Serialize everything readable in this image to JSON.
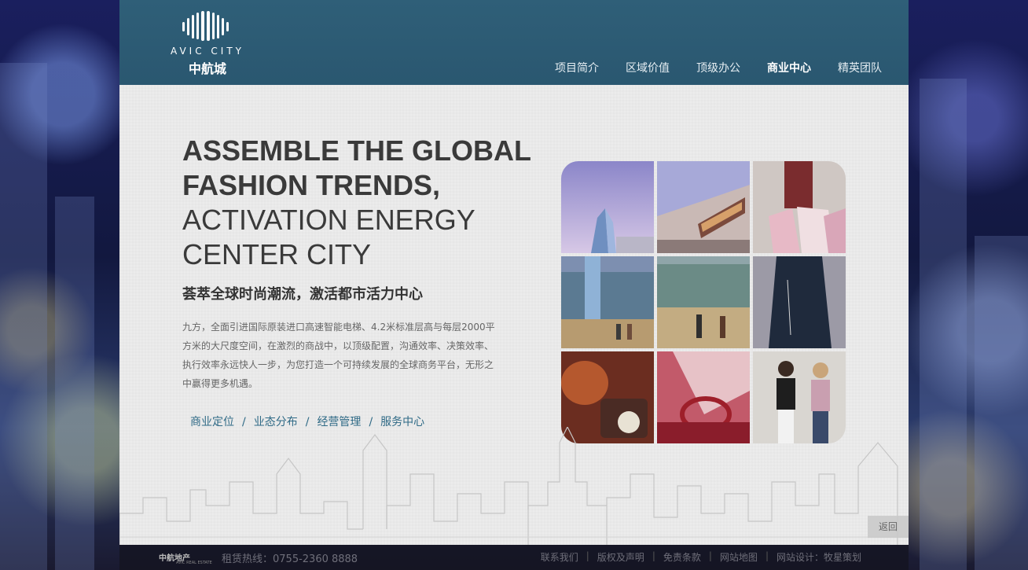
{
  "brand": {
    "logo_en": "AVIC CITY",
    "logo_cn": "中航城"
  },
  "nav": {
    "items": [
      {
        "label": "项目简介"
      },
      {
        "label": "区域价值"
      },
      {
        "label": "顶级办公"
      },
      {
        "label": "商业中心"
      },
      {
        "label": "精英团队"
      }
    ],
    "active_index": 3
  },
  "hero": {
    "headline_bold_1": "ASSEMBLE THE GLOBAL",
    "headline_bold_2": "FASHION TRENDS,",
    "headline_regular_1": "ACTIVATION ENERGY",
    "headline_regular_2": "CENTER CITY",
    "subtitle": "荟萃全球时尚潮流，激活都市活力中心",
    "description": "九方，全面引进国际原装进口高速智能电梯、4.2米标准层高与每层2000平方米的大尺度空间，在激烈的商战中，以顶级配置，沟通效率、决策效率、执行效率永远快人一步，为您打造一个可持续发展的全球商务平台，无形之中赢得更多机遇。"
  },
  "sub_links": [
    {
      "label": "商业定位"
    },
    {
      "label": "业态分布"
    },
    {
      "label": "经营管理"
    },
    {
      "label": "服务中心"
    }
  ],
  "sub_links_separator": "/",
  "back_button": "返回",
  "footer": {
    "logo": "中航地产",
    "logo_sub": "AVIC REAL ESTATE",
    "hotline": "租赁热线：0755-2360 8888",
    "links": [
      {
        "label": "联系我们"
      },
      {
        "label": "版权及声明"
      },
      {
        "label": "免责条款"
      },
      {
        "label": "网站地图"
      },
      {
        "label": "网站设计：牧星策划"
      }
    ],
    "separator": "|"
  },
  "colors": {
    "header": "#2f5f78",
    "accent_link": "#2f6a86",
    "page_bg": "#ececec"
  }
}
